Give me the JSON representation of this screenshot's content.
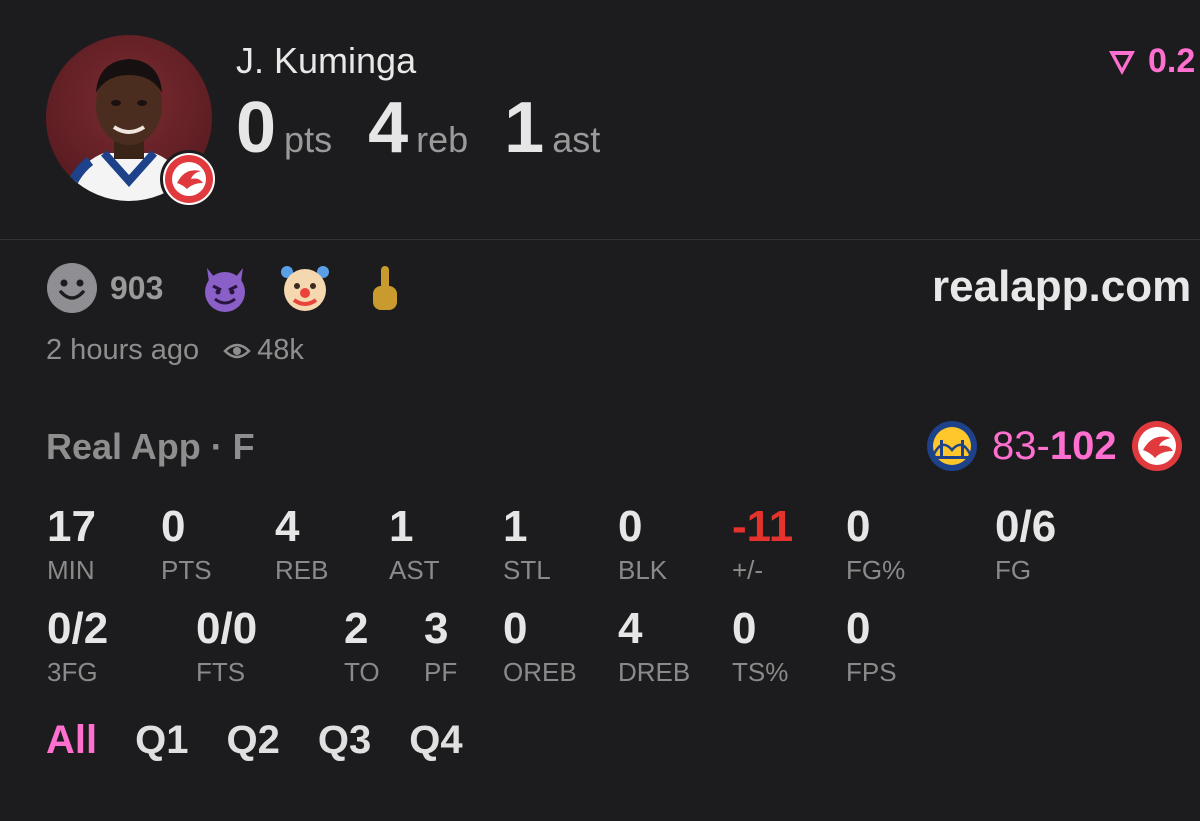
{
  "player": {
    "name": "J. Kuminga"
  },
  "headline": [
    {
      "value": "0",
      "unit": "pts"
    },
    {
      "value": "4",
      "unit": "reb"
    },
    {
      "value": "1",
      "unit": "ast"
    }
  ],
  "rating": {
    "value": "0.2"
  },
  "reactions": {
    "count": "903"
  },
  "site": "realapp.com",
  "meta": {
    "time": "2 hours ago",
    "views": "48k"
  },
  "game": {
    "source": "Real App · F",
    "score_away": "83",
    "score_sep": "-",
    "score_home": "102"
  },
  "stats_row1": [
    {
      "value": "17",
      "label": "MIN"
    },
    {
      "value": "0",
      "label": "PTS"
    },
    {
      "value": "4",
      "label": "REB"
    },
    {
      "value": "1",
      "label": "AST"
    },
    {
      "value": "1",
      "label": "STL"
    },
    {
      "value": "0",
      "label": "BLK"
    },
    {
      "value": "-11",
      "label": "+/-"
    },
    {
      "value": "0",
      "label": "FG%"
    },
    {
      "value": "0/6",
      "label": "FG"
    }
  ],
  "stats_row2": [
    {
      "value": "0/2",
      "label": "3FG"
    },
    {
      "value": "0/0",
      "label": "FTS"
    },
    {
      "value": "2",
      "label": "TO"
    },
    {
      "value": "3",
      "label": "PF"
    },
    {
      "value": "0",
      "label": "OREB"
    },
    {
      "value": "4",
      "label": "DREB"
    },
    {
      "value": "0",
      "label": "TS%"
    },
    {
      "value": "0",
      "label": "FPS"
    }
  ],
  "periods": [
    "All",
    "Q1",
    "Q2",
    "Q3",
    "Q4"
  ],
  "colors": {
    "accent": "#ff6fcf",
    "negative": "#e5322d",
    "background": "#1c1c1e"
  },
  "icons": [
    "smiley-icon",
    "devil-emoji",
    "clown-emoji",
    "middle-finger-emoji",
    "eye-icon",
    "rating-arrow-icon",
    "warriors-logo",
    "hawks-logo"
  ]
}
